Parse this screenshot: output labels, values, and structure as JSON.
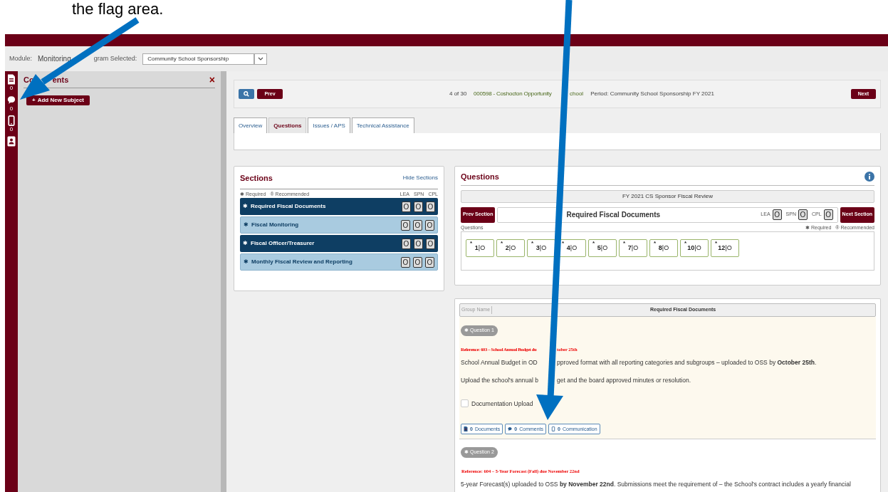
{
  "annotation": "the flag area.",
  "module_bar": {
    "module_label": "Module:",
    "module": "Monitoring",
    "program_label": "gram Selected:",
    "program": "Community School Sponsorship"
  },
  "rail": [
    {
      "kind": "document",
      "count": "0"
    },
    {
      "kind": "comment",
      "count": "0"
    },
    {
      "kind": "phone",
      "count": "0"
    },
    {
      "kind": "contact"
    }
  ],
  "comments_panel": {
    "title_parts": [
      "Co",
      "ents"
    ],
    "close": "×",
    "add_mark": "+",
    "add_button": "Add New Subject"
  },
  "nav": {
    "prev": "Prev",
    "position": "4 of 30",
    "school_parts": [
      "000598 - Coshocton Opportunity",
      "chool"
    ],
    "period": "Period: Community School Sponsorship FY 2021",
    "next": "Next"
  },
  "tabs": [
    {
      "label": "Overview",
      "selected": false
    },
    {
      "label": "Questions",
      "selected": true
    },
    {
      "label": "Issues / APS",
      "selected": false
    },
    {
      "label": "Technical Assistance",
      "selected": false
    }
  ],
  "sections": {
    "title": "Sections",
    "hide_link": "Hide Sections",
    "legend": [
      {
        "mark": "✱",
        "label": "Required"
      },
      {
        "mark": "®",
        "label": "Recommended"
      }
    ],
    "columns": [
      "LEA",
      "SPN",
      "CPL"
    ],
    "items": [
      {
        "mark": "✱",
        "label": "Required Fiscal Documents",
        "highlighted": true,
        "statuses": [
          "O",
          "O",
          "O"
        ]
      },
      {
        "mark": "✱",
        "label": "Fiscal Monitoring",
        "highlighted": false,
        "statuses": [
          "O",
          "O",
          "O"
        ]
      },
      {
        "mark": "✱",
        "label": "Fiscal Officer/Treasurer",
        "highlighted": true,
        "statuses": [
          "O",
          "O",
          "O"
        ]
      },
      {
        "mark": "✱",
        "label": "Monthly Fiscal Review and Reporting",
        "highlighted": false,
        "statuses": [
          "O",
          "O",
          "O"
        ]
      }
    ]
  },
  "questions_panel": {
    "title": "Questions",
    "review": "FY 2021 CS Sponsor Fiscal Review",
    "prev_section": "Prev Section",
    "section_name": "Required Fiscal Documents",
    "next_section": "Next Section",
    "counts": [
      {
        "label": "LEA",
        "value": "O"
      },
      {
        "label": "SPN",
        "value": "O"
      },
      {
        "label": "CPL",
        "value": "O"
      }
    ],
    "questions_label": "Questions",
    "legend": [
      {
        "mark": "✱",
        "label": "Required"
      },
      {
        "mark": "®",
        "label": "Recommended"
      }
    ],
    "tiles": [
      {
        "mark": "*",
        "number": "1",
        "separator": "|",
        "status": "O"
      },
      {
        "mark": "*",
        "number": "2",
        "separator": "|",
        "status": "O"
      },
      {
        "mark": "*",
        "number": "3",
        "separator": "|",
        "status": "O"
      },
      {
        "mark": "*",
        "number": "4",
        "separator": "|",
        "status": "O"
      },
      {
        "mark": "*",
        "number": "5",
        "separator": "|",
        "status": "O"
      },
      {
        "mark": "*",
        "number": "7",
        "separator": "|",
        "status": "O"
      },
      {
        "mark": "*",
        "number": "8",
        "separator": "|",
        "status": "O"
      },
      {
        "mark": "*",
        "number": "10",
        "separator": "|",
        "status": "O"
      },
      {
        "mark": "*",
        "number": "12",
        "separator": "|",
        "status": "O"
      }
    ]
  },
  "group": {
    "name_label": "Group Name",
    "name": "Required Fiscal Documents"
  },
  "questions": [
    {
      "badge_mark": "✱",
      "badge": "Question 1",
      "highlighted": true,
      "reference": [
        "Reference: 603 – School Annual Budget du",
        "tober 25th"
      ],
      "paragraphs": [
        [
          "School Annual Budget in OD",
          "pproved format with all reporting categories and subgroups – uploaded to OSS by **October 25th**."
        ],
        [
          "Upload the school's annual b",
          "get and the board approved minutes or resolution."
        ]
      ],
      "checkbox": {
        "label": "Documentation Upload",
        "checked": false
      },
      "buttons": [
        {
          "kind": "document",
          "count": "0",
          "label": "Documents"
        },
        {
          "kind": "comment",
          "count": "0",
          "label": "Comments"
        },
        {
          "kind": "phone",
          "count": "0",
          "label": "Communication"
        }
      ]
    },
    {
      "badge_mark": "✱",
      "badge": "Question 2",
      "highlighted": false,
      "reference": [
        "Reference: 604 – 5-Year Forecast (Fall) due November 22nd"
      ],
      "paragraphs": [
        [
          "5-year Forecast(s) uploaded to OSS **by November 22nd**. Submissions meet the requirement of – the School's contract includes a yearly financial"
        ]
      ]
    }
  ]
}
